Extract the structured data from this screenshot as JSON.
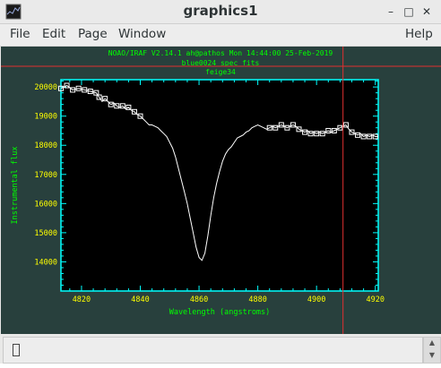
{
  "window": {
    "title": "graphics1",
    "minimize_glyph": "–",
    "maximize_glyph": "□",
    "close_glyph": "✕"
  },
  "menu": {
    "file": "File",
    "edit": "Edit",
    "page": "Page",
    "window": "Window",
    "help": "Help"
  },
  "plot_header": {
    "line1": "NOAO/IRAF V2.14.1 ah@pathos Mon 14:44:00 25-Feb-2019",
    "line2": "blue0024 spec fits",
    "line3": "feige34"
  },
  "colors": {
    "canvas_bg": "#28403d",
    "plot_bg": "#000000",
    "frame": "#00ffff",
    "text": "#00ff00",
    "ticks_text": "#ffff00",
    "spectrum": "#ffffff",
    "cursor": "#e03030"
  },
  "chart_data": {
    "type": "line",
    "xlabel": "Wavelength (angstroms)",
    "ylabel": "Instrumental flux",
    "xlim": [
      4813,
      4921
    ],
    "ylim": [
      13000,
      20250
    ],
    "xticks": [
      4820,
      4840,
      4860,
      4880,
      4900,
      4920
    ],
    "yticks": [
      14000,
      15000,
      16000,
      17000,
      18000,
      19000,
      20000
    ],
    "cursor_x": 4909,
    "series": [
      {
        "points": [
          [
            4813,
            19950
          ],
          [
            4815,
            20050
          ],
          [
            4817,
            19900
          ],
          [
            4819,
            19950
          ],
          [
            4821,
            19900
          ],
          [
            4823,
            19850
          ],
          [
            4825,
            19800
          ],
          [
            4826,
            19650
          ],
          [
            4827,
            19500
          ],
          [
            4828,
            19600
          ],
          [
            4829,
            19500
          ],
          [
            4830,
            19400
          ],
          [
            4831,
            19450
          ],
          [
            4832,
            19350
          ],
          [
            4833,
            19300
          ],
          [
            4834,
            19350
          ],
          [
            4835,
            19250
          ],
          [
            4836,
            19300
          ],
          [
            4837,
            19200
          ],
          [
            4838,
            19150
          ],
          [
            4839,
            19050
          ],
          [
            4840,
            19000
          ],
          [
            4841,
            18900
          ],
          [
            4842,
            18800
          ],
          [
            4843,
            18700
          ],
          [
            4844,
            18700
          ],
          [
            4845,
            18650
          ],
          [
            4846,
            18600
          ],
          [
            4847,
            18500
          ],
          [
            4848,
            18400
          ],
          [
            4849,
            18300
          ],
          [
            4850,
            18100
          ],
          [
            4851,
            17900
          ],
          [
            4852,
            17600
          ],
          [
            4853,
            17200
          ],
          [
            4854,
            16800
          ],
          [
            4855,
            16400
          ],
          [
            4856,
            16000
          ],
          [
            4857,
            15500
          ],
          [
            4858,
            15000
          ],
          [
            4859,
            14500
          ],
          [
            4860,
            14150
          ],
          [
            4861,
            14050
          ],
          [
            4862,
            14300
          ],
          [
            4863,
            14900
          ],
          [
            4864,
            15600
          ],
          [
            4865,
            16200
          ],
          [
            4866,
            16700
          ],
          [
            4867,
            17100
          ],
          [
            4868,
            17450
          ],
          [
            4869,
            17700
          ],
          [
            4870,
            17850
          ],
          [
            4871,
            17950
          ],
          [
            4872,
            18100
          ],
          [
            4873,
            18250
          ],
          [
            4874,
            18300
          ],
          [
            4875,
            18350
          ],
          [
            4876,
            18450
          ],
          [
            4877,
            18500
          ],
          [
            4878,
            18600
          ],
          [
            4879,
            18650
          ],
          [
            4880,
            18700
          ],
          [
            4881,
            18650
          ],
          [
            4882,
            18600
          ],
          [
            4883,
            18550
          ],
          [
            4884,
            18600
          ],
          [
            4885,
            18650
          ],
          [
            4886,
            18600
          ],
          [
            4887,
            18650
          ],
          [
            4888,
            18700
          ],
          [
            4889,
            18650
          ],
          [
            4890,
            18600
          ],
          [
            4891,
            18650
          ],
          [
            4892,
            18700
          ],
          [
            4893,
            18650
          ],
          [
            4894,
            18550
          ],
          [
            4895,
            18500
          ],
          [
            4896,
            18450
          ],
          [
            4897,
            18500
          ],
          [
            4898,
            18400
          ],
          [
            4899,
            18450
          ],
          [
            4900,
            18400
          ],
          [
            4901,
            18450
          ],
          [
            4902,
            18400
          ],
          [
            4903,
            18450
          ],
          [
            4904,
            18500
          ],
          [
            4905,
            18450
          ],
          [
            4906,
            18500
          ],
          [
            4907,
            18550
          ],
          [
            4908,
            18600
          ],
          [
            4909,
            18650
          ],
          [
            4910,
            18700
          ],
          [
            4911,
            18550
          ],
          [
            4912,
            18450
          ],
          [
            4913,
            18400
          ],
          [
            4914,
            18350
          ],
          [
            4915,
            18400
          ],
          [
            4916,
            18300
          ],
          [
            4917,
            18350
          ],
          [
            4918,
            18300
          ],
          [
            4919,
            18350
          ],
          [
            4920,
            18300
          ],
          [
            4921,
            18300
          ]
        ]
      }
    ],
    "marker_points": [
      [
        4813,
        19950
      ],
      [
        4815,
        20050
      ],
      [
        4817,
        19900
      ],
      [
        4819,
        19950
      ],
      [
        4821,
        19900
      ],
      [
        4823,
        19850
      ],
      [
        4825,
        19800
      ],
      [
        4826,
        19650
      ],
      [
        4828,
        19600
      ],
      [
        4830,
        19400
      ],
      [
        4832,
        19350
      ],
      [
        4834,
        19350
      ],
      [
        4836,
        19300
      ],
      [
        4838,
        19150
      ],
      [
        4840,
        19000
      ],
      [
        4884,
        18600
      ],
      [
        4886,
        18600
      ],
      [
        4888,
        18700
      ],
      [
        4890,
        18600
      ],
      [
        4892,
        18700
      ],
      [
        4894,
        18550
      ],
      [
        4896,
        18450
      ],
      [
        4898,
        18400
      ],
      [
        4900,
        18400
      ],
      [
        4902,
        18400
      ],
      [
        4904,
        18500
      ],
      [
        4906,
        18500
      ],
      [
        4908,
        18600
      ],
      [
        4910,
        18700
      ],
      [
        4912,
        18450
      ],
      [
        4914,
        18350
      ],
      [
        4916,
        18300
      ],
      [
        4918,
        18300
      ],
      [
        4920,
        18300
      ]
    ]
  }
}
